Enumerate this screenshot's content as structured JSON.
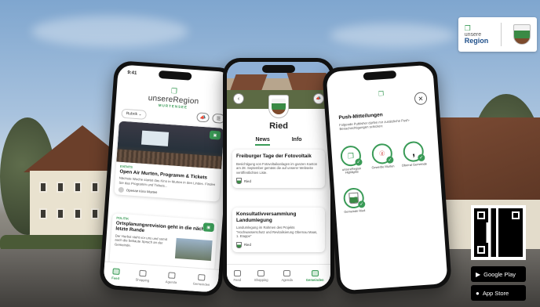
{
  "phone1": {
    "time": "9:41",
    "brand_top": "unsere",
    "brand_region": "Region",
    "brand_sub": "MURTENSEE",
    "filter_chip": "Rubrik",
    "card1": {
      "tag": "EVENTS",
      "title": "Open Air Murten, Programm & Tickets",
      "text": "Nächste Woche startet das Kino in Murten in den Lindes. Finden Sie das Programm und Tickets...",
      "source": "Openair Kino Murten"
    },
    "card2": {
      "tag": "POLITIK",
      "title": "Ortsplanungsrevision geht in die nächste, letzte Runde",
      "text": "Der Herbst steht vor uns und somit auch die bebaute Sprach an der Gemeinde."
    },
    "tabs": [
      "Feed",
      "Shopping",
      "Agenda",
      "Gemeinden"
    ]
  },
  "phone2": {
    "place": "Ried",
    "tab_news": "News",
    "tab_info": "Info",
    "card1": {
      "title": "Freiburger Tage der Fotovoltaik",
      "text": "Besichtigung von Fotovoltaikanlagen im ganzen Kanton am 28. September gemäss die auf unserer Webseite veröffentlichten Liste.",
      "source": "Ried"
    },
    "card2": {
      "title": "Konsultativversammlung Landumlegung",
      "text": "Landumlegung im Rahmen des Projekts \"Hochwasserschutz und Revitalisierung Obernau Maas, 1. Etappe\"",
      "source": "Ried"
    },
    "tabs": [
      "Feed",
      "Shopping",
      "Agenda",
      "Gemeinden"
    ]
  },
  "phone3": {
    "title": "Push-Mitteilungen",
    "text": "Folgende Publisher dürfen mir zusätzliche Push-Benachrichtigungen schicken:",
    "items": [
      {
        "label": "unsereRegion Highlights",
        "icon": "chat-logo-icon"
      },
      {
        "label": "Gewerbe Murten",
        "icon": "gewerbe-logo-icon"
      },
      {
        "label": "Oberrat Gemeinde",
        "icon": "comma-logo-icon"
      },
      {
        "label": "Gemeinde Ried",
        "icon": "crest-icon"
      }
    ]
  },
  "brand_box": {
    "line1": "unsere",
    "line2": "Region"
  },
  "stores": {
    "google": "Google Play",
    "apple": "App Store"
  },
  "colors": {
    "accent": "#3a9b57",
    "brand_blue": "#1f4f8a"
  }
}
